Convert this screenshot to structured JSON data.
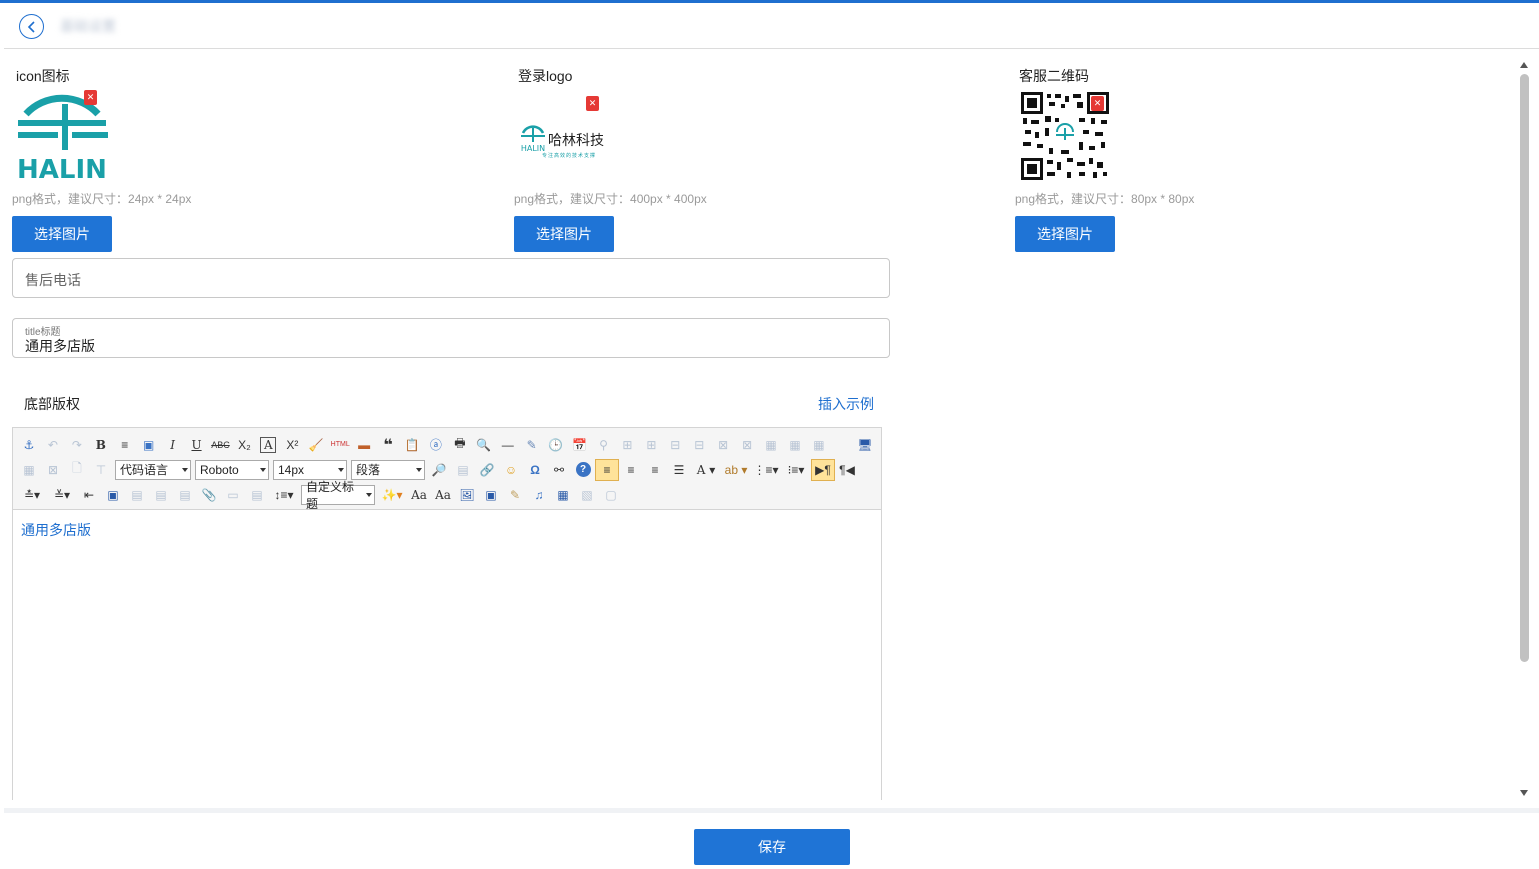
{
  "header": {
    "title": "基础设置"
  },
  "uploaders": [
    {
      "label": "icon图标",
      "hint": "png格式，建议尺寸：24px * 24px",
      "button": "选择图片"
    },
    {
      "label": "登录logo",
      "hint": "png格式，建议尺寸：400px * 400px",
      "button": "选择图片",
      "logo_text": "哈林科技",
      "logo_sub": "专注高效的技术支撑"
    },
    {
      "label": "客服二维码",
      "hint": "png格式，建议尺寸：80px * 80px",
      "button": "选择图片"
    }
  ],
  "form": {
    "phone_placeholder": "售后电话",
    "title_label": "title标题",
    "title_value": "通用多店版"
  },
  "copyright": {
    "label": "底部版权",
    "insert_link": "插入示例"
  },
  "editor": {
    "code_lang": "代码语言",
    "font_family": "Roboto",
    "font_size": "14px",
    "paragraph": "段落",
    "custom_title": "自定义标题",
    "content": "通用多店版"
  },
  "footer": {
    "save": "保存"
  },
  "colors": {
    "primary": "#1f74d6",
    "delete": "#e53935",
    "logo_teal": "#1aa0a8"
  }
}
